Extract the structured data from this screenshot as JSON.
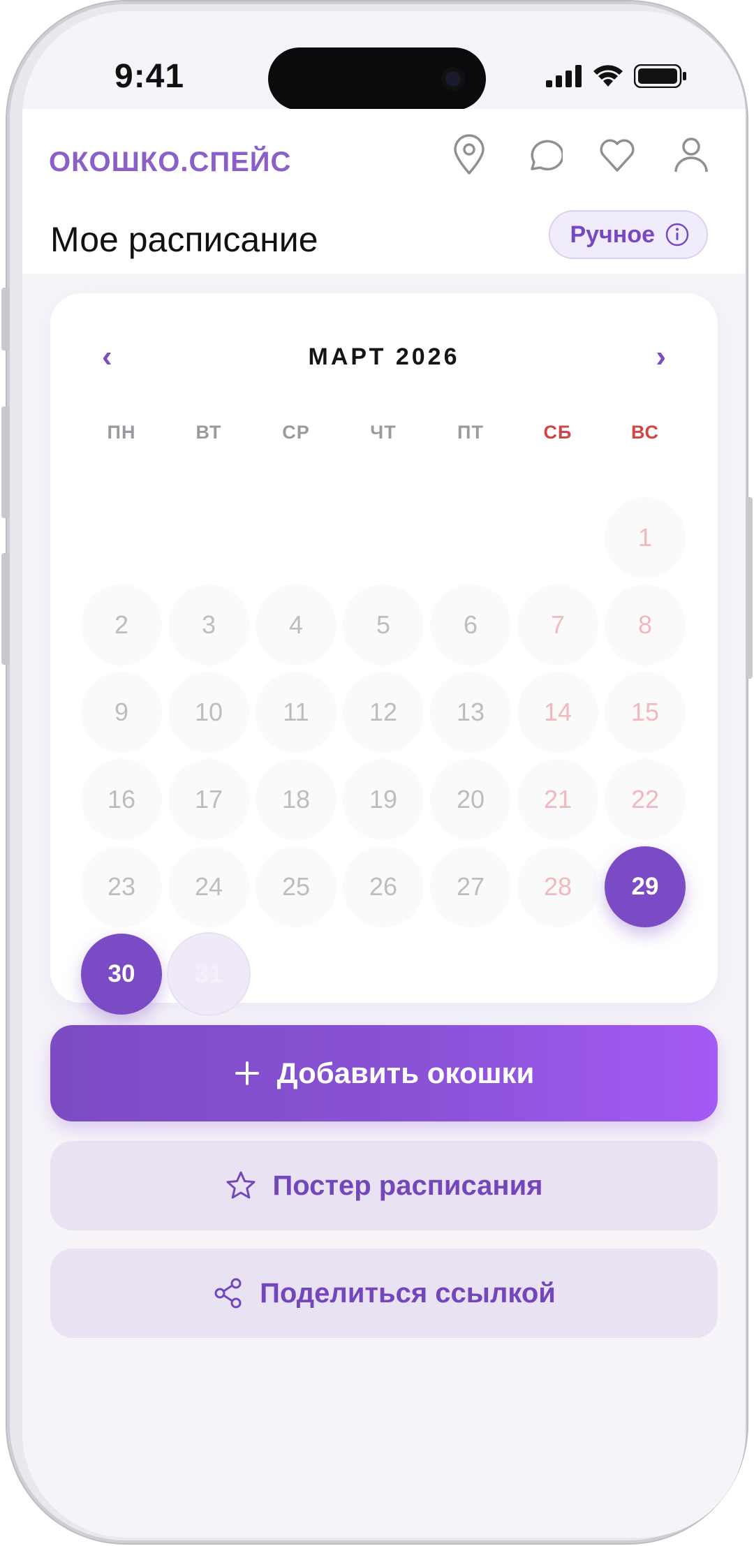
{
  "status_bar": {
    "time": "9:41"
  },
  "header": {
    "logo": "ОКОШКО.СПЕЙС",
    "icons": [
      "location-icon",
      "chat-icon",
      "heart-icon",
      "profile-icon"
    ],
    "title": "Мое расписание",
    "mode_pill": "Ручное"
  },
  "calendar": {
    "month_label": "МАРТ 2026",
    "prev": "‹",
    "next": "›",
    "weekdays": [
      "ПН",
      "ВТ",
      "СР",
      "ЧТ",
      "ПТ",
      "СБ",
      "ВС"
    ],
    "weekend_indices": [
      5,
      6
    ],
    "first_weekday_index": 6,
    "days_in_month": 31,
    "selected_days": [
      29,
      30
    ],
    "highlighted_days": [
      31
    ]
  },
  "actions": {
    "add": "Добавить окошки",
    "poster": "Постер расписания",
    "share": "Поделиться ссылкой"
  },
  "colors": {
    "accent": "#7a4bc4",
    "accent_light": "#a45af4",
    "weekend": "#d34545"
  }
}
